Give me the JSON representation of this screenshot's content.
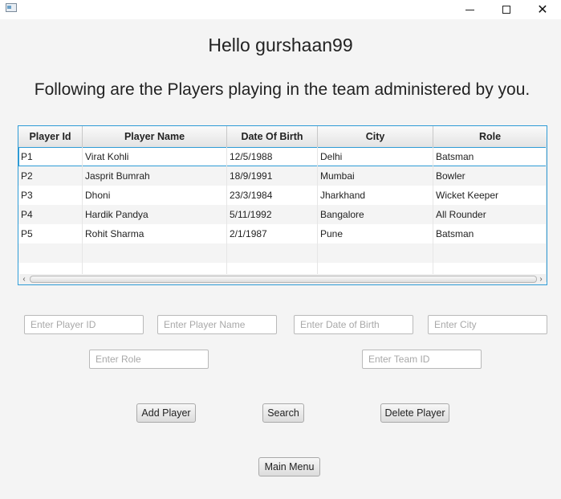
{
  "header": {
    "greeting": "Hello gurshaan99",
    "subtitle": "Following are the Players playing in the team administered by you."
  },
  "table": {
    "columns": [
      "Player Id",
      "Player Name",
      "Date Of Birth",
      "City",
      "Role"
    ],
    "rows": [
      [
        "P1",
        "Virat Kohli",
        "12/5/1988",
        "Delhi",
        "Batsman"
      ],
      [
        "P2",
        "Jasprit Bumrah",
        "18/9/1991",
        "Mumbai",
        "Bowler"
      ],
      [
        "P3",
        "Dhoni",
        "23/3/1984",
        "Jharkhand",
        "Wicket Keeper"
      ],
      [
        "P4",
        "Hardik Pandya",
        "5/11/1992",
        "Bangalore",
        "All Rounder"
      ],
      [
        "P5",
        "Rohit Sharma",
        "2/1/1987",
        "Pune",
        "Batsman"
      ]
    ]
  },
  "form": {
    "player_id_placeholder": "Enter Player ID",
    "player_name_placeholder": "Enter Player Name",
    "dob_placeholder": "Enter Date of Birth",
    "city_placeholder": "Enter City",
    "role_placeholder": "Enter Role",
    "team_id_placeholder": "Enter Team ID"
  },
  "buttons": {
    "add": "Add Player",
    "search": "Search",
    "delete": "Delete Player",
    "main_menu": "Main Menu"
  },
  "colors": {
    "accent": "#2e9bd6",
    "background": "#f4f4f4"
  }
}
